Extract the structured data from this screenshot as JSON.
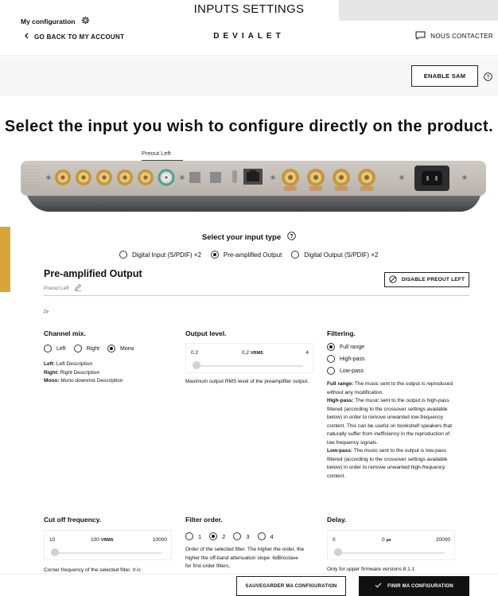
{
  "window": {
    "title": "INPUTS SETTINGS"
  },
  "nav": {
    "back_label": "GO BACK TO MY ACCOUNT",
    "brand": "DEVIALET",
    "contact_label": "NOUS CONTACTER"
  },
  "config": {
    "label": "My configuration",
    "enable_sam_label": "ENABLE SAM"
  },
  "headline": "Select the input you wish to configure directly on the product.",
  "device": {
    "selected_port_label": "Preout Left"
  },
  "input_type": {
    "title": "Select your input type",
    "options": [
      {
        "label": "Digital Input (S/PDIF) ×2",
        "selected": false
      },
      {
        "label": "Pre-amplified Output",
        "selected": true
      },
      {
        "label": "Digital Output (S/PDIF) ×2",
        "selected": false
      }
    ]
  },
  "output": {
    "title": "Pre-amplified Output",
    "subtitle": "Preout Left",
    "disable_label": "DISABLE PREOUT LEFT",
    "stray_text": "/>"
  },
  "channel_mix": {
    "title": "Channel mix.",
    "options": [
      {
        "label": "Left",
        "selected": false
      },
      {
        "label": "Right",
        "selected": false
      },
      {
        "label": "Mono",
        "selected": true
      }
    ],
    "desc": [
      {
        "key": "Left:",
        "text": " Left Description"
      },
      {
        "key": "Right:",
        "text": " Right Description"
      },
      {
        "key": "Mono:",
        "text": " Mono downmix Description"
      }
    ]
  },
  "output_level": {
    "title": "Output level.",
    "min": "0.2",
    "value": "0,2",
    "unit": "VRMS",
    "max": "4",
    "desc": "Maximum output RMS level of the preamplifier output."
  },
  "filtering": {
    "title": "Filtering.",
    "options": [
      {
        "label": "Full range",
        "selected": true
      },
      {
        "label": "High-pass",
        "selected": false
      },
      {
        "label": "Low-pass",
        "selected": false
      }
    ],
    "desc": [
      {
        "key": "Full range:",
        "text": " The music sent to the output is reproduced without any modification."
      },
      {
        "key": "High-pass:",
        "text": " The music sent to the output is high-pass filtered (according to the crossover settings available below) in order to remove unwanted low-frequency content. This can be useful on bookshelf speakers that naturally suffer from inefficiency in the reproduction of low frequency signals."
      },
      {
        "key": "Low-pass:",
        "text": " The music sent to the output is low-pass filtered (according to the crossover settings available below) in order to remove unwanted high-frequency content."
      }
    ]
  },
  "cutoff": {
    "title": "Cut off frequency.",
    "min": "10",
    "value": "100",
    "unit": "VRMS",
    "max": "10000",
    "desc": "Corner frequency of the selected filter. It is"
  },
  "filter_order": {
    "title": "Filter order.",
    "options": [
      {
        "label": "1",
        "selected": false
      },
      {
        "label": "2",
        "selected": true
      },
      {
        "label": "3",
        "selected": false
      },
      {
        "label": "4",
        "selected": false
      }
    ],
    "desc": "Order of the selected filter. The higher the order, the higher the off-band attenuation slope: 6dB/octave for first-order filters,"
  },
  "delay": {
    "title": "Delay.",
    "min": "0",
    "value": "0",
    "unit": "µs",
    "max": "20000",
    "note": "Only for upper firmware versions 8.1.1"
  },
  "actions": {
    "save_label": "SAUVEGARDER MA CONFIGURATION",
    "finish_label": "FINIR MA CONFIGURATION"
  }
}
